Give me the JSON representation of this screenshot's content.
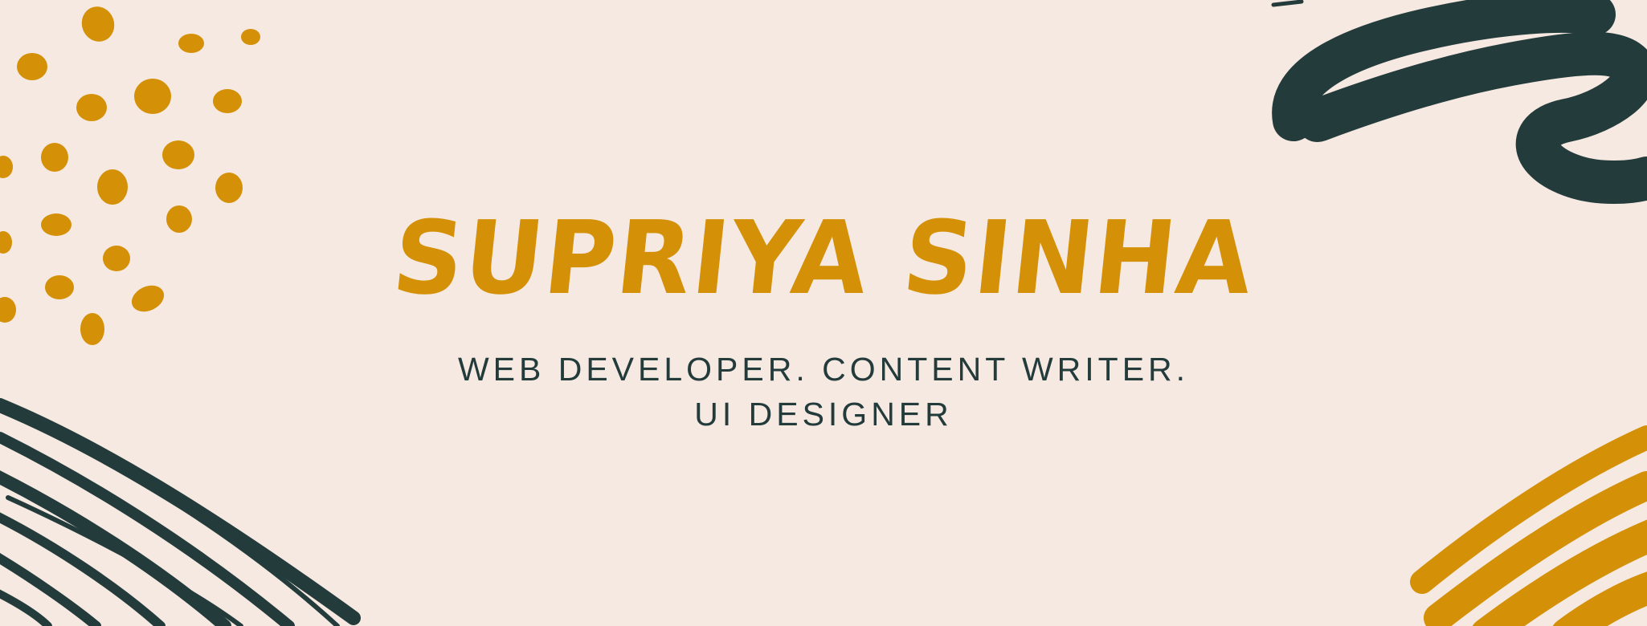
{
  "name": "SUPRIYA SINHA",
  "tagline_line1": "WEB DEVELOPER. CONTENT WRITER.",
  "tagline_line2": "UI DESIGNER",
  "colors": {
    "background": "#f6e9e2",
    "accent": "#d49006",
    "dark": "#233b3b"
  }
}
